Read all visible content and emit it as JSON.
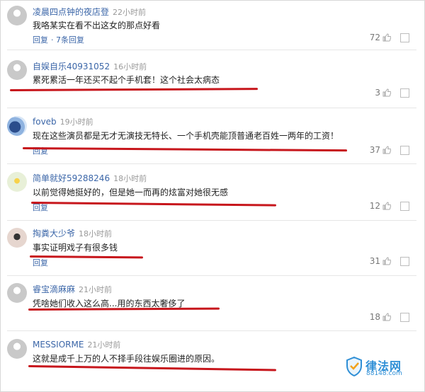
{
  "comments": [
    {
      "user": "凌晨四点钟的夜店登",
      "time": "22小时前",
      "text": "我咯某实在看不出这女的那点好看",
      "reply": "回复",
      "sub_replies": "· 7条回复",
      "likes": "72"
    },
    {
      "user": "自娱自乐40931052",
      "time": "16小时前",
      "text": "累死累活一年还买不起个手机套！这个社会太病态",
      "reply": "回复",
      "likes": "3"
    },
    {
      "user": "foveb",
      "time": "19小时前",
      "text": "现在这些演员都是无才无演技无特长、一个手机壳能顶普通老百姓一两年的工资！",
      "reply": "回复",
      "likes": "37"
    },
    {
      "user": "简单就好59288246",
      "time": "18小时前",
      "text": "以前觉得她挺好的，但是她一而再的炫富对她很无感",
      "reply": "回复",
      "likes": "12"
    },
    {
      "user": "掏粪大少爷",
      "time": "18小时前",
      "text": "事实证明戏子有很多钱",
      "reply": "回复",
      "likes": "31"
    },
    {
      "user": "睿宝滴麻麻",
      "time": "21小时前",
      "text": "凭啥她们收入这么高...用的东西太奢侈了",
      "reply": "回复",
      "likes": "18"
    },
    {
      "user": "MESSIORME",
      "time": "21小时前",
      "text": "这就是成千上万的人不择手段往娱乐圈进的原因。",
      "reply": "回复",
      "likes": ""
    }
  ],
  "watermark": {
    "name": "律法网",
    "url": "88148.com"
  },
  "colors": {
    "username": "#3b66a8",
    "underline": "#c7161c",
    "watermark": "#2f8fd6"
  },
  "icons": {
    "like": "thumbs-up-icon",
    "option": "checkbox-square"
  }
}
